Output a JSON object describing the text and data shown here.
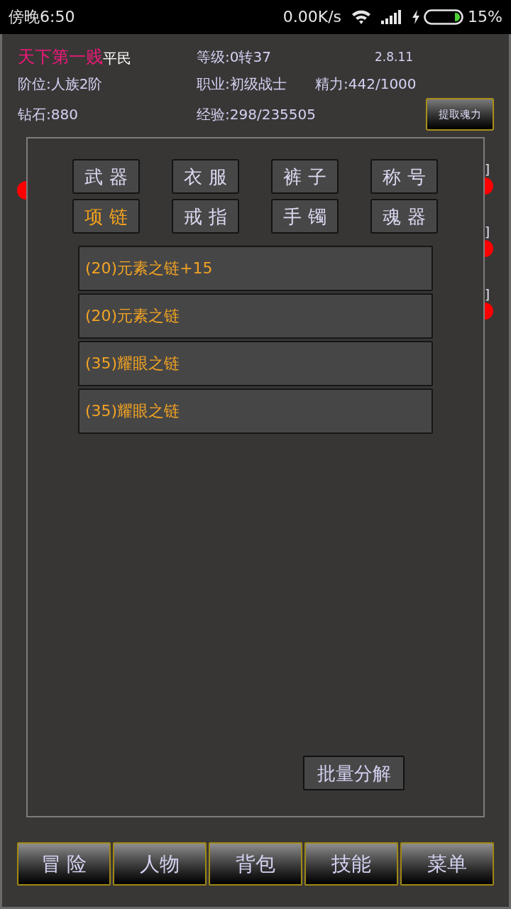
{
  "status_bar": {
    "time": "傍晚6:50",
    "net_speed": "0.00K/s",
    "battery": "15%"
  },
  "player": {
    "name": "天下第一贱",
    "title": "平民",
    "level": "等级:0转37",
    "version": "2.8.11",
    "rank": "阶位:人族2阶",
    "job": "职业:初级战士",
    "energy": "精力:442/1000",
    "diamonds": "钻石:880",
    "exp": "经验:298/235505"
  },
  "extract_button": "提取魂力",
  "right_edge": [
    {
      "text": "]"
    },
    {
      "text": "]"
    },
    {
      "text": "]"
    }
  ],
  "dialog": {
    "categories": [
      {
        "label": "武 器",
        "selected": false
      },
      {
        "label": "衣 服",
        "selected": false
      },
      {
        "label": "裤 子",
        "selected": false
      },
      {
        "label": "称 号",
        "selected": false
      },
      {
        "label": "项 链",
        "selected": true
      },
      {
        "label": "戒 指",
        "selected": false
      },
      {
        "label": "手 镯",
        "selected": false
      },
      {
        "label": "魂 器",
        "selected": false
      }
    ],
    "items": [
      {
        "name": "(20)元素之链+15"
      },
      {
        "name": "(20)元素之链"
      },
      {
        "name": "(35)耀眼之链"
      },
      {
        "name": "(35)耀眼之链"
      }
    ],
    "batch_button": "批量分解"
  },
  "nav": [
    {
      "label": "冒 险"
    },
    {
      "label": "人物"
    },
    {
      "label": "背包"
    },
    {
      "label": "技能"
    },
    {
      "label": "菜单"
    }
  ]
}
